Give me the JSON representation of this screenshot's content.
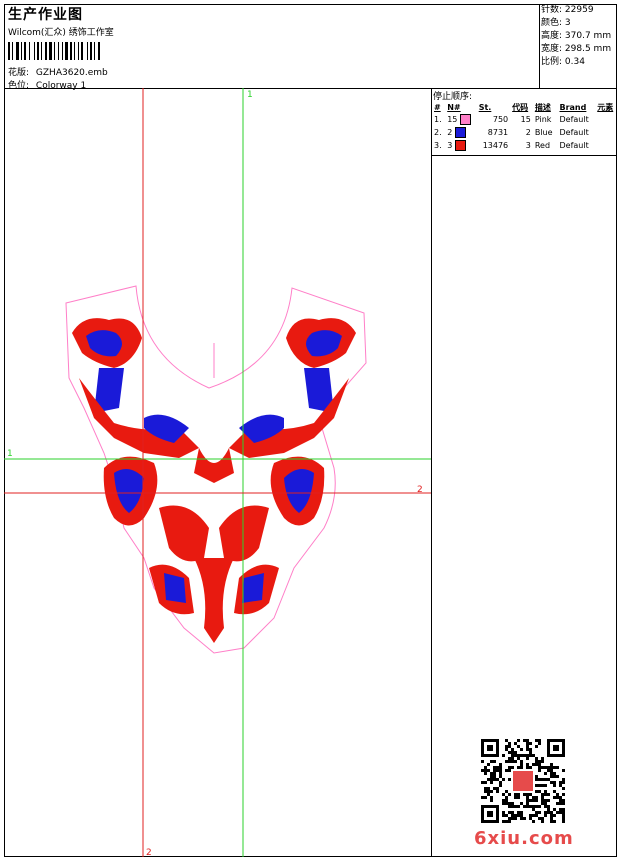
{
  "header": {
    "title": "生产作业图",
    "subtitle": "Wilcom(汇众) 绣饰工作室",
    "design_label": "花版:",
    "design_value": "GZHA3620.emb",
    "colorway_label": "色位:",
    "colorway_value": "Colorway 1"
  },
  "stats": [
    {
      "label": "针数:",
      "value": "22959"
    },
    {
      "label": "颜色:",
      "value": "3"
    },
    {
      "label": "高度:",
      "value": "370.7 mm"
    },
    {
      "label": "宽度:",
      "value": "298.5 mm"
    },
    {
      "label": "比例:",
      "value": "0.34"
    }
  ],
  "stop_sequence": {
    "title": "停止顺序:",
    "columns": [
      "#",
      "N#",
      "St.",
      "代码",
      "描述",
      "Brand",
      "元素"
    ],
    "rows": [
      {
        "index": "1.",
        "needle": "15",
        "color": "#ff7fc8",
        "stitches": "750",
        "code": "15",
        "desc": "Pink",
        "brand": "Default"
      },
      {
        "index": "2.",
        "needle": "2",
        "color": "#1a1ad8",
        "stitches": "8731",
        "code": "2",
        "desc": "Blue",
        "brand": "Default"
      },
      {
        "index": "3.",
        "needle": "3",
        "color": "#e81a10",
        "stitches": "13476",
        "code": "3",
        "desc": "Red",
        "brand": "Default"
      }
    ]
  },
  "guides": {
    "green_v_label": "1",
    "green_h_label": "1",
    "red_h_label": "2",
    "red_v_label": "2"
  },
  "colors": {
    "pink": "#ff7fc8",
    "blue": "#1a1ad8",
    "red": "#e81a10",
    "guide_green": "#2bd12b",
    "guide_red": "#e02020"
  },
  "watermark": {
    "logo_text": "6xiu.com"
  }
}
